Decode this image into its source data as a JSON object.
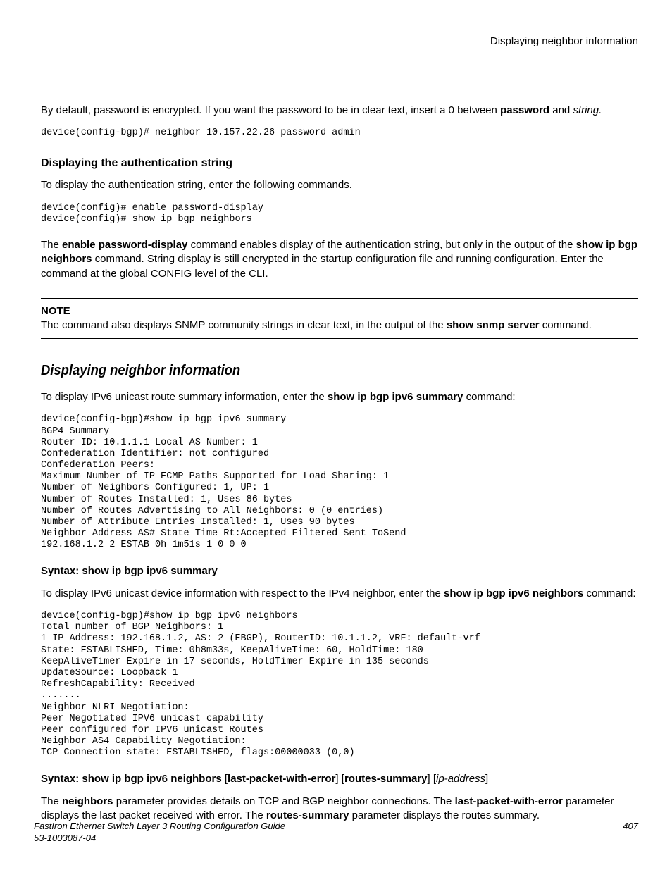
{
  "header": {
    "running": "Displaying neighbor information"
  },
  "intro": {
    "p1_a": "By default, password is encrypted. If you want the password to be in clear text, insert a 0 between ",
    "p1_b": "password",
    "p1_c": " and ",
    "p1_d": "string.",
    "code1": "device(config-bgp)# neighbor 10.157.22.26 password admin"
  },
  "auth": {
    "heading": "Displaying the authentication string",
    "p1": "To display the authentication string, enter the following commands.",
    "code": "device(config)# enable password-display\ndevice(config)# show ip bgp neighbors",
    "p2_a": "The ",
    "p2_b": "enable password-display",
    "p2_c": " command enables display of the authentication string, but only in the output of the ",
    "p2_d": "show ip bgp neighbors",
    "p2_e": " command. String display is still encrypted in the startup configuration file and running configuration. Enter the command at the global CONFIG level of the CLI."
  },
  "note": {
    "label": "NOTE",
    "text_a": "The command also displays SNMP community strings in clear text, in the output of the ",
    "text_b": "show snmp server",
    "text_c": " command."
  },
  "neigh": {
    "heading": "Displaying neighbor information",
    "p1_a": "To display IPv6 unicast route summary information, enter the ",
    "p1_b": "show ip bgp ipv6 summary",
    "p1_c": " command:",
    "code1": "device(config-bgp)#show ip bgp ipv6 summary\nBGP4 Summary\nRouter ID: 10.1.1.1 Local AS Number: 1\nConfederation Identifier: not configured\nConfederation Peers:\nMaximum Number of IP ECMP Paths Supported for Load Sharing: 1\nNumber of Neighbors Configured: 1, UP: 1\nNumber of Routes Installed: 1, Uses 86 bytes\nNumber of Routes Advertising to All Neighbors: 0 (0 entries)\nNumber of Attribute Entries Installed: 1, Uses 90 bytes\nNeighbor Address AS# State Time Rt:Accepted Filtered Sent ToSend\n192.168.1.2 2 ESTAB 0h 1m51s 1 0 0 0",
    "syntax1": "Syntax: show ip bgp ipv6 summary",
    "p2_a": "To display IPv6 unicast device information with respect to the IPv4 neighbor, enter the ",
    "p2_b": "show ip bgp ipv6 neighbors",
    "p2_c": " command:",
    "code2": "device(config-bgp)#show ip bgp ipv6 neighbors\nTotal number of BGP Neighbors: 1\n1 IP Address: 192.168.1.2, AS: 2 (EBGP), RouterID: 10.1.1.2, VRF: default-vrf\nState: ESTABLISHED, Time: 0h8m33s, KeepAliveTime: 60, HoldTime: 180\nKeepAliveTimer Expire in 17 seconds, HoldTimer Expire in 135 seconds\nUpdateSource: Loopback 1\nRefreshCapability: Received\n.......\nNeighbor NLRI Negotiation:\nPeer Negotiated IPV6 unicast capability\nPeer configured for IPV6 unicast Routes\nNeighbor AS4 Capability Negotiation:\nTCP Connection state: ESTABLISHED, flags:00000033 (0,0)",
    "syntax2_a": "Syntax: show ip bgp ipv6 neighbors",
    "syntax2_b": "last-packet-with-error",
    "syntax2_c": "routes-summary",
    "syntax2_d": "ip-address",
    "p3_a": "The ",
    "p3_b": "neighbors",
    "p3_c": " parameter provides details on TCP and BGP neighbor connections. The ",
    "p3_d": "last-packet-with-error",
    "p3_e": " parameter displays the last packet received with error. The ",
    "p3_f": "routes-summary",
    "p3_g": " parameter displays the routes summary."
  },
  "footer": {
    "title": "FastIron Ethernet Switch Layer 3 Routing Configuration Guide",
    "docnum": "53-1003087-04",
    "page": "407"
  }
}
